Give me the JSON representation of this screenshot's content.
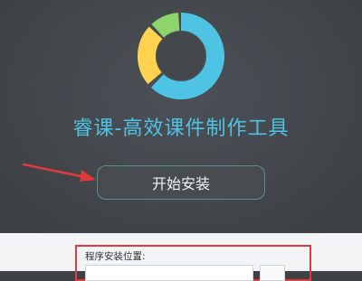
{
  "app": {
    "title": "睿课-高效课件制作工具",
    "logo_colors": [
      "#4fc3e4",
      "#8fd36c",
      "#ffd24f"
    ]
  },
  "actions": {
    "install_label": "开始安装"
  },
  "install_location": {
    "label": "程序安装位置:",
    "path_value": ""
  },
  "colors": {
    "accent": "#4fc3e4",
    "highlight_border": "#e03a3a",
    "annotation_arrow": "#e03a3a",
    "background": "#43474c"
  }
}
